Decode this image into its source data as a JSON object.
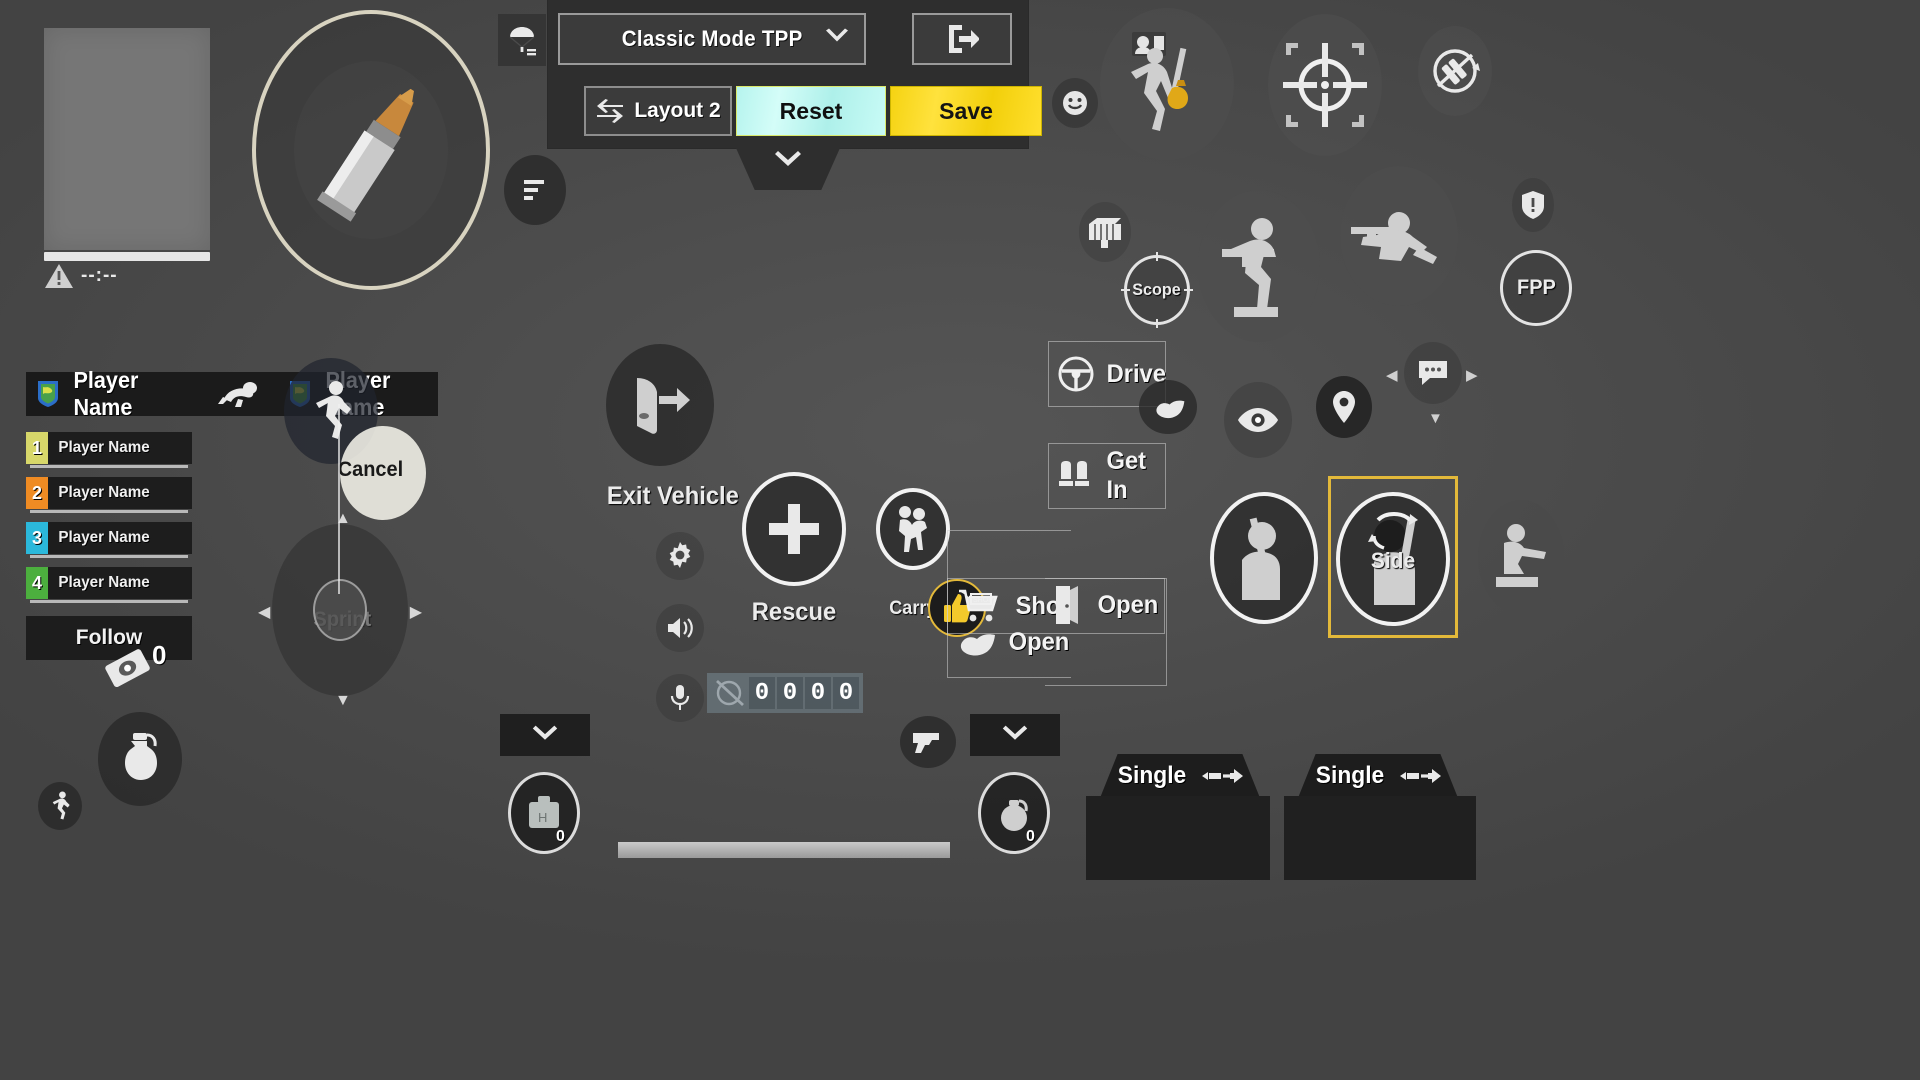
{
  "panel": {
    "mode_value": "Classic Mode TPP",
    "mode_chevron": "chevron-down-icon",
    "exit_icon": "exit-door-icon",
    "parachute_icon": "parachute-swap-icon",
    "layout_label": "Layout 2",
    "layout_icon": "swap-arrows-icon",
    "reset_label": "Reset",
    "save_label": "Save",
    "collapse_icon": "chevron-down-icon",
    "colors": {
      "reset_bg": "#c3f7f1",
      "save_bg": "#f7d417",
      "panel_bg": "#2e2e2e",
      "selected_outline": "#e3b93a"
    }
  },
  "hud": {
    "minimap_timer": "--:--",
    "warning_icon": "warning-triangle-icon"
  },
  "team": {
    "strip": [
      {
        "name": "Player Name",
        "icon": "shield-icon"
      },
      {
        "name": "Player Name",
        "icon": "shield-icon"
      }
    ],
    "crawl_icon": "crawl-icon",
    "sprint_icon": "sprint-icon",
    "rows": [
      {
        "num": "1",
        "name": "Player Name",
        "color": "#d7d76a"
      },
      {
        "num": "2",
        "name": "Player Name",
        "color": "#ef8b23"
      },
      {
        "num": "3",
        "name": "Player Name",
        "color": "#2bb8db"
      },
      {
        "num": "4",
        "name": "Player Name",
        "color": "#4caf3e"
      }
    ],
    "follow_label": "Follow",
    "follow_count": "0",
    "follow_icon": "eye-tag-icon"
  },
  "joystick": {
    "sprint_label": "Sprint",
    "cancel_label": "Cancel",
    "runner_icon": "running-man-icon"
  },
  "center": {
    "exit_vehicle_label": "Exit Vehicle",
    "exit_vehicle_icon": "car-door-exit-icon",
    "settings_icon": "gear-icon",
    "sound_icon": "speaker-icon",
    "mic_icon": "microphone-icon",
    "rescue_label": "Rescue",
    "rescue_icon": "plus-icon",
    "carry_label": "Carry",
    "carry_icon": "carry-person-icon",
    "thumbs_up_icon": "thumbs-up-icon",
    "ammo_digits": [
      "0",
      "0",
      "0",
      "0"
    ],
    "ammo_muted_icon": "mic-muted-icon"
  },
  "interactions": [
    {
      "label": "Shop",
      "icon": "shopping-cart-icon"
    },
    {
      "label": "Open",
      "icon": "door-open-icon"
    },
    {
      "label": "Open",
      "icon": "pointing-hand-icon"
    }
  ],
  "vehicle": {
    "drive_label": "Drive",
    "drive_icon": "steering-wheel-icon",
    "get_in_label": "Get In",
    "get_in_icon": "car-seats-icon",
    "hand_icon": "pointing-hand-icon"
  },
  "right_actions": {
    "emote_icon": "smiley-icon",
    "pickup_icon": "pickup-loot-icon",
    "aim_icon": "crosshair-icon",
    "grenade_cycle_icon": "grenade-swap-icon",
    "backpack_icon": "backpack-crate-icon",
    "scope_label": "Scope",
    "crouch_icon": "crouch-shoot-icon",
    "prone_icon": "prone-icon",
    "alert_icon": "alert-shield-icon",
    "fpp_label": "FPP",
    "eye_icon": "eye-icon",
    "marker_icon": "map-pin-icon",
    "chat_icon": "chat-bubble-icon",
    "peek_left_icon": "peek-left-icon",
    "peek_side_label": "Side",
    "peek_side_icon": "peek-side-icon",
    "vault_icon": "vault-icon"
  },
  "weapons": {
    "slot_left": {
      "fire_mode": "Single",
      "mode_icon": "bullet-arrow-icon"
    },
    "slot_right": {
      "fire_mode": "Single",
      "mode_icon": "bullet-arrow-icon"
    },
    "pistol_icon": "pistol-icon",
    "chevron_icon": "chevron-down-icon",
    "medkit_icon": "medkit-icon",
    "medkit_count": "0",
    "grenade_icon": "grenade-icon",
    "grenade_count": "0",
    "throwable_icon": "frag-grenade-icon",
    "crouch_toggle_icon": "crouch-icon"
  }
}
